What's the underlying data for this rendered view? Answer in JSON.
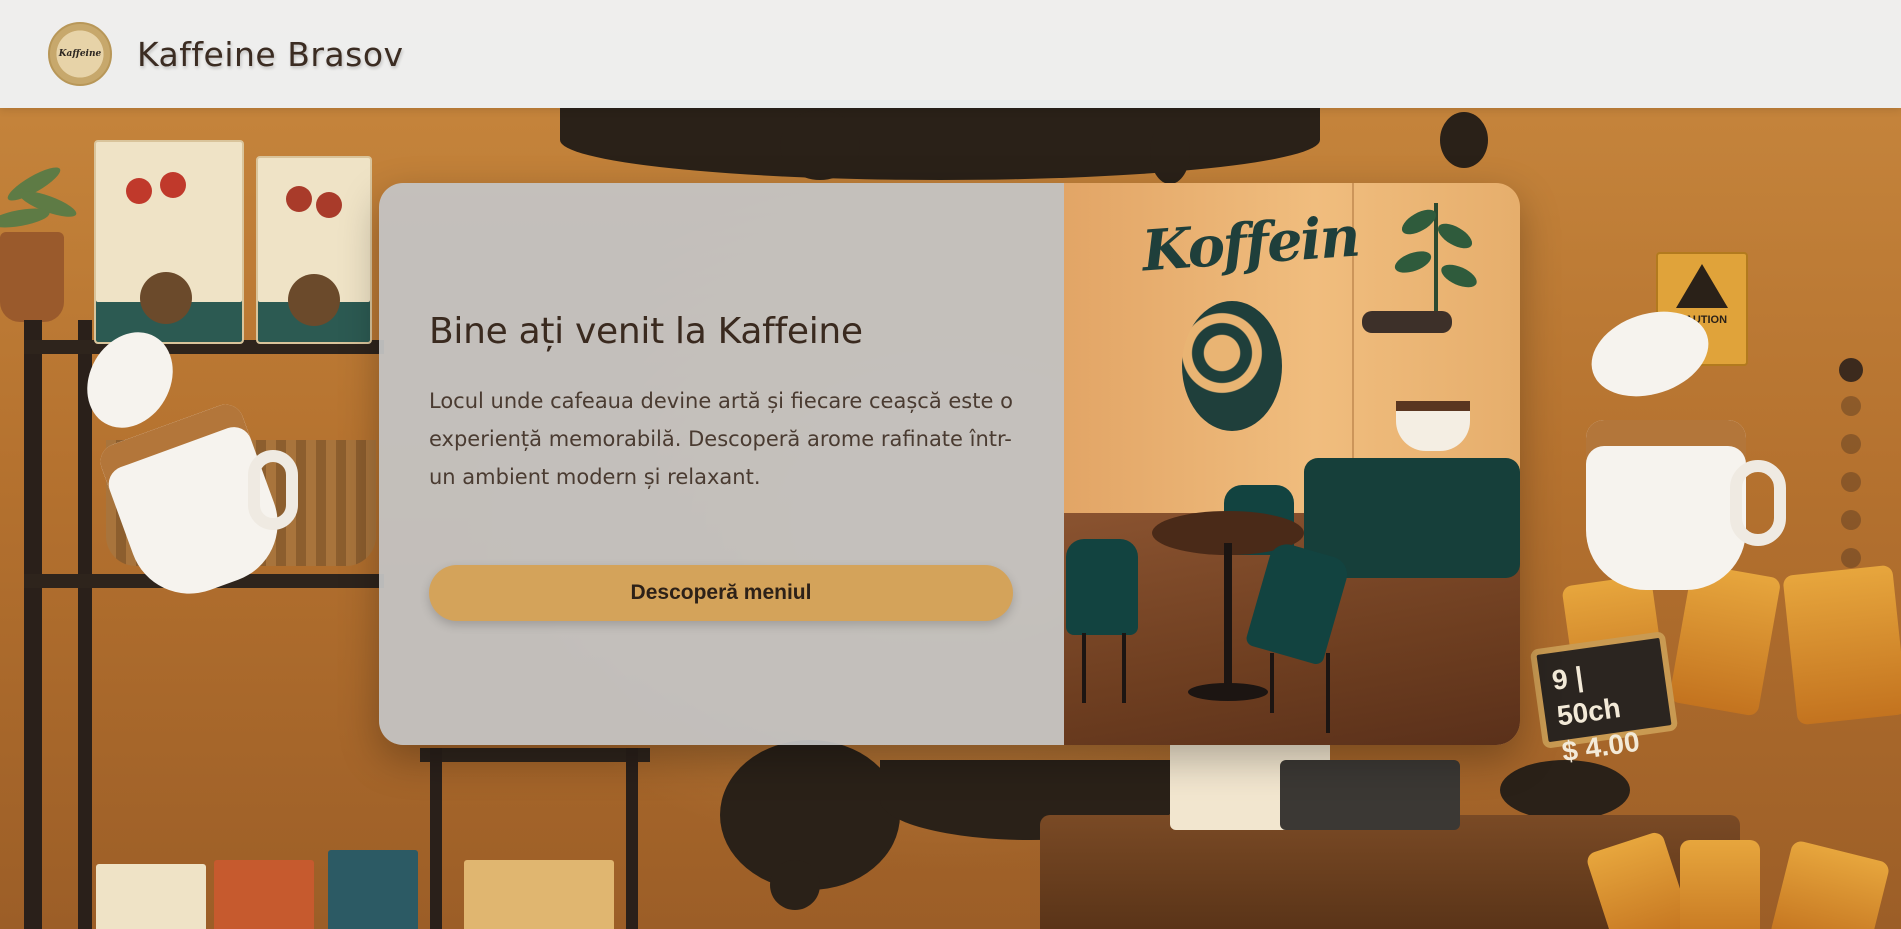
{
  "header": {
    "logo_text": "Kaffeine",
    "brand_name": "Kaffeine Brasov"
  },
  "hero": {
    "title": "Bine ați venit la Kaffeine",
    "description": "Locul unde cafeaua devine artă și fiecare ceașcă este o experiență memorabilă. Descoperă arome rafinate într-un ambient modern și relaxant.",
    "cta_label": "Descoperă meniul",
    "wall_logo": "Koffein"
  },
  "background": {
    "caution_sign": "CAUTION",
    "price_sign_line1": "9 | 50ch",
    "price_sign_line2": "$ 4.00"
  },
  "pagination": {
    "count": 6,
    "active_index": 0
  },
  "colors": {
    "accent": "#d4a35a",
    "text_dark": "#3a2a1f",
    "header_bg": "#f0f2f3",
    "card_bg": "#c4c4c4"
  }
}
